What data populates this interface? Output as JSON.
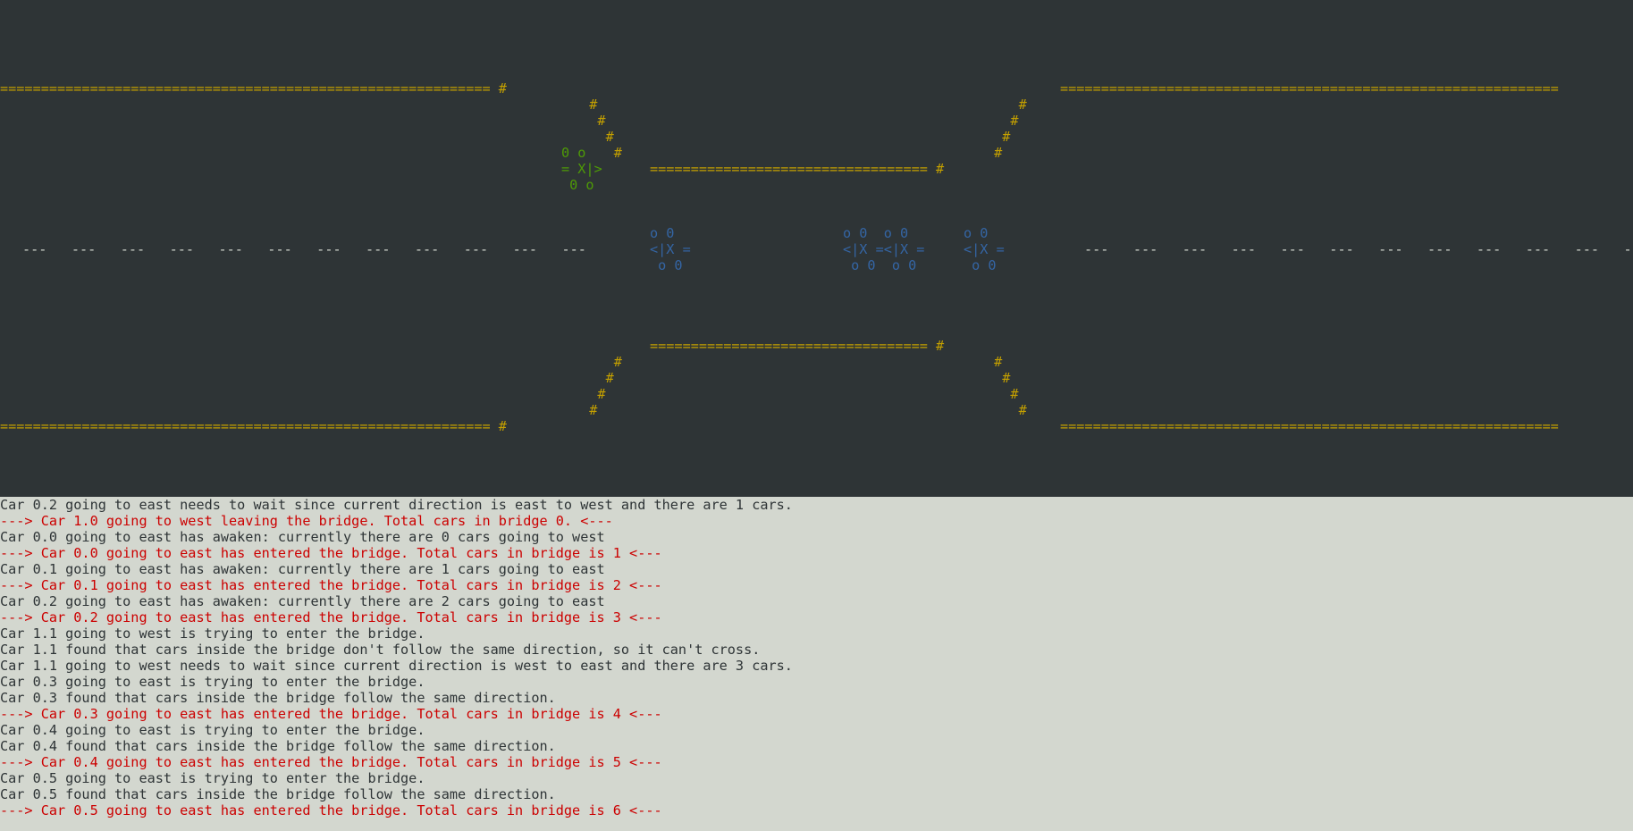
{
  "terminal": {
    "bridge_scene": {
      "colors": {
        "background": "#2e3436",
        "road": "#c4a000",
        "waiting_car": "#4e9a06",
        "bridge_car": "#3465a4",
        "lane_marks": "#d3d7cf"
      },
      "top_left_road": "============================================================ #",
      "top_right_road": "=============================================================",
      "bottom_left_road": "============================================================ #",
      "bottom_right_road": "=============================================================",
      "top_left_ramp": "  #\n   #\n    #\n     #",
      "top_right_ramp": "    #\n   #\n  #\n #",
      "bottom_left_ramp": "     #\n    #\n   #\n  #",
      "bottom_right_ramp": " #\n  #\n   #\n    #",
      "bridge_top_rail": "================================== #",
      "bridge_bottom_rail": "================================== #",
      "waiting_car": "0 o\n= X|>\n 0 o",
      "bridge_car_1": "o 0\n<|X =\n o 0",
      "bridge_car_2": "o 0  o 0\n<|X =<|X =\n o 0  o 0",
      "bridge_car_3": "o 0\n<|X =\n o 0",
      "west_lane_marks": "---   ---   ---   ---   ---   ---   ---   ---   ---   ---   ---   ---",
      "east_lane_marks": "---   ---   ---   ---   ---   ---   ---   ---   ---   ---   ---   ---   ---"
    },
    "log": [
      {
        "type": "info",
        "text": "Car 0.2 going to east needs to wait since current direction is east to west and there are 1 cars."
      },
      {
        "type": "alert",
        "text": "---> Car 1.0 going to west leaving the bridge. Total cars in bridge 0. <---"
      },
      {
        "type": "info",
        "text": "Car 0.0 going to east has awaken: currently there are 0 cars going to west"
      },
      {
        "type": "alert",
        "text": "---> Car 0.0 going to east has entered the bridge. Total cars in bridge is 1 <---"
      },
      {
        "type": "info",
        "text": "Car 0.1 going to east has awaken: currently there are 1 cars going to east"
      },
      {
        "type": "alert",
        "text": "---> Car 0.1 going to east has entered the bridge. Total cars in bridge is 2 <---"
      },
      {
        "type": "info",
        "text": "Car 0.2 going to east has awaken: currently there are 2 cars going to east"
      },
      {
        "type": "alert",
        "text": "---> Car 0.2 going to east has entered the bridge. Total cars in bridge is 3 <---"
      },
      {
        "type": "info",
        "text": "Car 1.1 going to west is trying to enter the bridge."
      },
      {
        "type": "info",
        "text": "Car 1.1 found that cars inside the bridge don't follow the same direction, so it can't cross."
      },
      {
        "type": "info",
        "text": "Car 1.1 going to west needs to wait since current direction is west to east and there are 3 cars."
      },
      {
        "type": "info",
        "text": "Car 0.3 going to east is trying to enter the bridge."
      },
      {
        "type": "info",
        "text": "Car 0.3 found that cars inside the bridge follow the same direction."
      },
      {
        "type": "alert",
        "text": "---> Car 0.3 going to east has entered the bridge. Total cars in bridge is 4 <---"
      },
      {
        "type": "info",
        "text": "Car 0.4 going to east is trying to enter the bridge."
      },
      {
        "type": "info",
        "text": "Car 0.4 found that cars inside the bridge follow the same direction."
      },
      {
        "type": "alert",
        "text": "---> Car 0.4 going to east has entered the bridge. Total cars in bridge is 5 <---"
      },
      {
        "type": "info",
        "text": "Car 0.5 going to east is trying to enter the bridge."
      },
      {
        "type": "info",
        "text": "Car 0.5 found that cars inside the bridge follow the same direction."
      },
      {
        "type": "alert",
        "text": "---> Car 0.5 going to east has entered the bridge. Total cars in bridge is 6 <---"
      }
    ]
  }
}
